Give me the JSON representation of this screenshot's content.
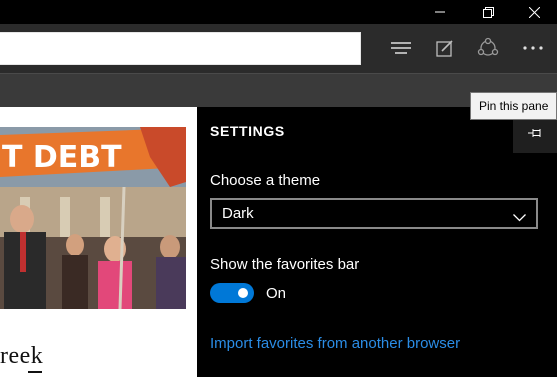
{
  "window": {
    "controls": [
      {
        "name": "minimize-button",
        "icon": "minimize-icon"
      },
      {
        "name": "restore-button",
        "icon": "restore-icon"
      },
      {
        "name": "close-button",
        "icon": "close-icon"
      }
    ]
  },
  "toolbar": {
    "address_value": "",
    "buttons": [
      {
        "name": "hub-button",
        "icon": "hub-icon"
      },
      {
        "name": "web-note-button",
        "icon": "pen-icon"
      },
      {
        "name": "share-button",
        "icon": "share-icon"
      },
      {
        "name": "more-button",
        "icon": "more-icon"
      }
    ]
  },
  "webpage": {
    "headline_partial": "reek",
    "photo_banner": "T DEBT"
  },
  "settings": {
    "title": "SETTINGS",
    "pin_icon": "pin-icon",
    "theme_label": "Choose a theme",
    "theme_value": "Dark",
    "favorites_label": "Show the favorites bar",
    "favorites_state": "On",
    "import_link": "Import favorites from another browser"
  },
  "tooltip": {
    "text": "Pin this pane"
  },
  "colors": {
    "accent": "#0078d7",
    "link": "#2b8de6",
    "pane_bg": "#000000",
    "toolbar_bg": "#2b2b2b"
  }
}
